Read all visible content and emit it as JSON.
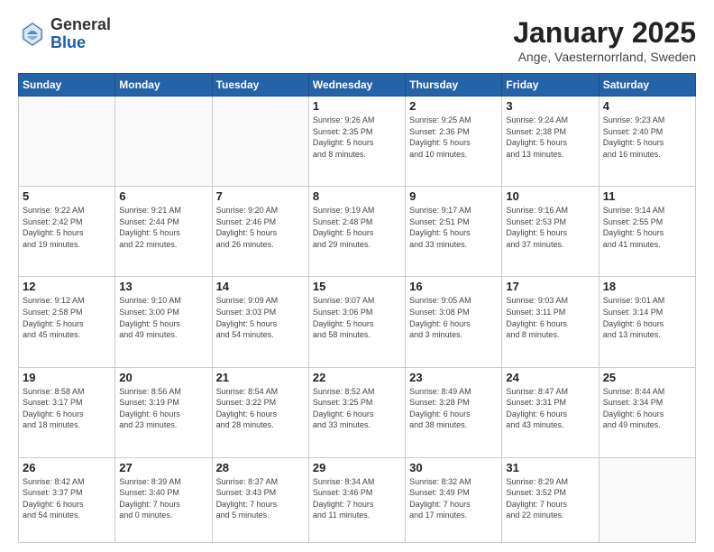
{
  "logo": {
    "general": "General",
    "blue": "Blue"
  },
  "header": {
    "title": "January 2025",
    "subtitle": "Ange, Vaesternorrland, Sweden"
  },
  "weekdays": [
    "Sunday",
    "Monday",
    "Tuesday",
    "Wednesday",
    "Thursday",
    "Friday",
    "Saturday"
  ],
  "weeks": [
    [
      {
        "day": "",
        "info": ""
      },
      {
        "day": "",
        "info": ""
      },
      {
        "day": "",
        "info": ""
      },
      {
        "day": "1",
        "info": "Sunrise: 9:26 AM\nSunset: 2:35 PM\nDaylight: 5 hours\nand 8 minutes."
      },
      {
        "day": "2",
        "info": "Sunrise: 9:25 AM\nSunset: 2:36 PM\nDaylight: 5 hours\nand 10 minutes."
      },
      {
        "day": "3",
        "info": "Sunrise: 9:24 AM\nSunset: 2:38 PM\nDaylight: 5 hours\nand 13 minutes."
      },
      {
        "day": "4",
        "info": "Sunrise: 9:23 AM\nSunset: 2:40 PM\nDaylight: 5 hours\nand 16 minutes."
      }
    ],
    [
      {
        "day": "5",
        "info": "Sunrise: 9:22 AM\nSunset: 2:42 PM\nDaylight: 5 hours\nand 19 minutes."
      },
      {
        "day": "6",
        "info": "Sunrise: 9:21 AM\nSunset: 2:44 PM\nDaylight: 5 hours\nand 22 minutes."
      },
      {
        "day": "7",
        "info": "Sunrise: 9:20 AM\nSunset: 2:46 PM\nDaylight: 5 hours\nand 26 minutes."
      },
      {
        "day": "8",
        "info": "Sunrise: 9:19 AM\nSunset: 2:48 PM\nDaylight: 5 hours\nand 29 minutes."
      },
      {
        "day": "9",
        "info": "Sunrise: 9:17 AM\nSunset: 2:51 PM\nDaylight: 5 hours\nand 33 minutes."
      },
      {
        "day": "10",
        "info": "Sunrise: 9:16 AM\nSunset: 2:53 PM\nDaylight: 5 hours\nand 37 minutes."
      },
      {
        "day": "11",
        "info": "Sunrise: 9:14 AM\nSunset: 2:55 PM\nDaylight: 5 hours\nand 41 minutes."
      }
    ],
    [
      {
        "day": "12",
        "info": "Sunrise: 9:12 AM\nSunset: 2:58 PM\nDaylight: 5 hours\nand 45 minutes."
      },
      {
        "day": "13",
        "info": "Sunrise: 9:10 AM\nSunset: 3:00 PM\nDaylight: 5 hours\nand 49 minutes."
      },
      {
        "day": "14",
        "info": "Sunrise: 9:09 AM\nSunset: 3:03 PM\nDaylight: 5 hours\nand 54 minutes."
      },
      {
        "day": "15",
        "info": "Sunrise: 9:07 AM\nSunset: 3:06 PM\nDaylight: 5 hours\nand 58 minutes."
      },
      {
        "day": "16",
        "info": "Sunrise: 9:05 AM\nSunset: 3:08 PM\nDaylight: 6 hours\nand 3 minutes."
      },
      {
        "day": "17",
        "info": "Sunrise: 9:03 AM\nSunset: 3:11 PM\nDaylight: 6 hours\nand 8 minutes."
      },
      {
        "day": "18",
        "info": "Sunrise: 9:01 AM\nSunset: 3:14 PM\nDaylight: 6 hours\nand 13 minutes."
      }
    ],
    [
      {
        "day": "19",
        "info": "Sunrise: 8:58 AM\nSunset: 3:17 PM\nDaylight: 6 hours\nand 18 minutes."
      },
      {
        "day": "20",
        "info": "Sunrise: 8:56 AM\nSunset: 3:19 PM\nDaylight: 6 hours\nand 23 minutes."
      },
      {
        "day": "21",
        "info": "Sunrise: 8:54 AM\nSunset: 3:22 PM\nDaylight: 6 hours\nand 28 minutes."
      },
      {
        "day": "22",
        "info": "Sunrise: 8:52 AM\nSunset: 3:25 PM\nDaylight: 6 hours\nand 33 minutes."
      },
      {
        "day": "23",
        "info": "Sunrise: 8:49 AM\nSunset: 3:28 PM\nDaylight: 6 hours\nand 38 minutes."
      },
      {
        "day": "24",
        "info": "Sunrise: 8:47 AM\nSunset: 3:31 PM\nDaylight: 6 hours\nand 43 minutes."
      },
      {
        "day": "25",
        "info": "Sunrise: 8:44 AM\nSunset: 3:34 PM\nDaylight: 6 hours\nand 49 minutes."
      }
    ],
    [
      {
        "day": "26",
        "info": "Sunrise: 8:42 AM\nSunset: 3:37 PM\nDaylight: 6 hours\nand 54 minutes."
      },
      {
        "day": "27",
        "info": "Sunrise: 8:39 AM\nSunset: 3:40 PM\nDaylight: 7 hours\nand 0 minutes."
      },
      {
        "day": "28",
        "info": "Sunrise: 8:37 AM\nSunset: 3:43 PM\nDaylight: 7 hours\nand 5 minutes."
      },
      {
        "day": "29",
        "info": "Sunrise: 8:34 AM\nSunset: 3:46 PM\nDaylight: 7 hours\nand 11 minutes."
      },
      {
        "day": "30",
        "info": "Sunrise: 8:32 AM\nSunset: 3:49 PM\nDaylight: 7 hours\nand 17 minutes."
      },
      {
        "day": "31",
        "info": "Sunrise: 8:29 AM\nSunset: 3:52 PM\nDaylight: 7 hours\nand 22 minutes."
      },
      {
        "day": "",
        "info": ""
      }
    ]
  ]
}
